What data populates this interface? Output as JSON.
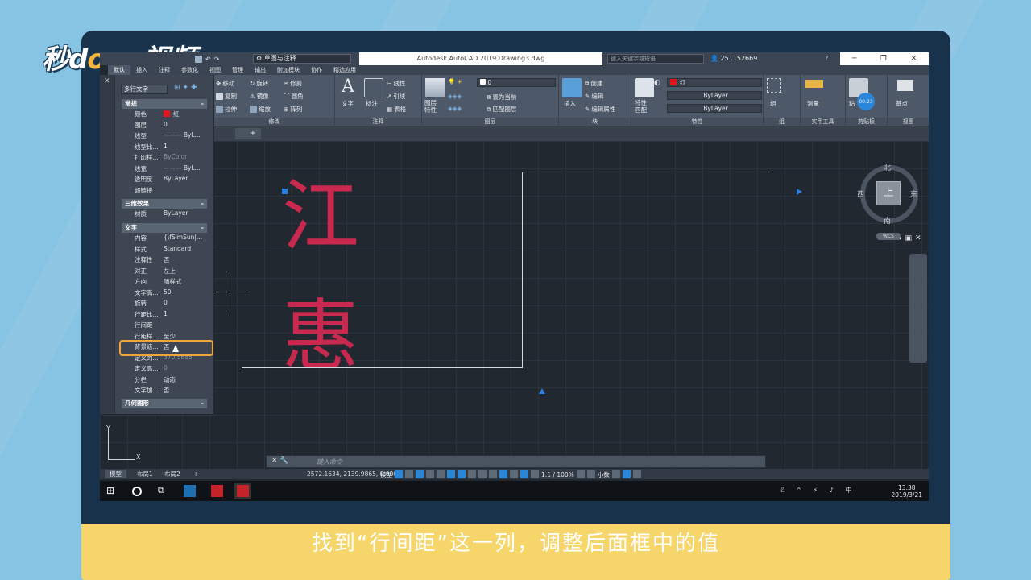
{
  "logo": {
    "text_a": "秒d",
    "dot": "o",
    "text_b": "ng视频"
  },
  "window": {
    "workspace": "草图与注释",
    "title": "Autodesk AutoCAD 2019    Drawing3.dwg",
    "search_placeholder": "键入关键字或短语",
    "user": "251152669",
    "help": "?"
  },
  "ribbon_tabs": [
    "默认",
    "插入",
    "注释",
    "参数化",
    "视图",
    "管理",
    "输出",
    "附加模块",
    "协作",
    "精选应用"
  ],
  "ribbon": {
    "modify": {
      "label": "修改",
      "move": "移动",
      "rotate": "旋转",
      "trim": "修剪",
      "copy": "复制",
      "mirror": "镜像",
      "fillet": "圆角",
      "stretch": "拉伸",
      "scale": "缩放",
      "array": "阵列"
    },
    "annotation": {
      "label": "注释",
      "text": "文字",
      "dim": "标注",
      "linear": "线性",
      "leader": "引线",
      "table": "表格"
    },
    "layers": {
      "label": "图层",
      "props": "图层\n特性",
      "current_layer": "0",
      "set_current": "置为当前",
      "match": "匹配图层"
    },
    "block": {
      "label": "块",
      "insert": "插入",
      "create": "创建",
      "edit": "编辑",
      "edit_attr": "编辑属性"
    },
    "properties": {
      "label": "特性",
      "match": "特性\n匹配",
      "color": "红",
      "linetype": "ByLayer",
      "lineweight": "ByLayer"
    },
    "groups": {
      "label": "组",
      "group": "组"
    },
    "utilities": {
      "label": "实用工具",
      "measure": "测量"
    },
    "clipboard": {
      "label": "剪贴板",
      "paste": "粘",
      "timer": "00:23"
    },
    "view": {
      "label": "视图",
      "base": "基点"
    }
  },
  "palette": {
    "selector": "多行文字",
    "sections": {
      "general": "常规",
      "three_d": "三维效果",
      "text": "文字",
      "geometry": "几何图形"
    },
    "general_rows": [
      {
        "k": "颜色",
        "v": "红",
        "swatch": true
      },
      {
        "k": "图层",
        "v": "0"
      },
      {
        "k": "线型",
        "v": "——— ByL..."
      },
      {
        "k": "线型比...",
        "v": "1"
      },
      {
        "k": "打印样...",
        "v": "ByColor",
        "dim": true
      },
      {
        "k": "线宽",
        "v": "——— ByL..."
      },
      {
        "k": "透明度",
        "v": "ByLayer"
      },
      {
        "k": "超链接",
        "v": ""
      }
    ],
    "three_d_rows": [
      {
        "k": "材质",
        "v": "ByLayer"
      }
    ],
    "text_rows": [
      {
        "k": "内容",
        "v": "{\\fSimSun|..."
      },
      {
        "k": "样式",
        "v": "Standard"
      },
      {
        "k": "注释性",
        "v": "否"
      },
      {
        "k": "对正",
        "v": "左上"
      },
      {
        "k": "方向",
        "v": "随样式"
      },
      {
        "k": "文字高...",
        "v": "50"
      },
      {
        "k": "旋转",
        "v": "0"
      },
      {
        "k": "行距比...",
        "v": "1"
      },
      {
        "k": "行间距",
        "v": ""
      },
      {
        "k": "行距样...",
        "v": "至少"
      },
      {
        "k": "背景遮...",
        "v": "否"
      },
      {
        "k": "定义的...",
        "v": "370.5685",
        "dim": true
      },
      {
        "k": "定义高...",
        "v": "0",
        "dim": true
      },
      {
        "k": "分栏",
        "v": "动态"
      },
      {
        "k": "文字加...",
        "v": "否"
      }
    ]
  },
  "drawing": {
    "char1": "江",
    "char2": "惠"
  },
  "viewcube": {
    "north": "北",
    "south": "南",
    "east": "东",
    "west": "西",
    "top": "上",
    "wcs": "WCS"
  },
  "command": {
    "placeholder": "键入命令"
  },
  "layout_tabs": [
    "模型",
    "布局1",
    "布局2",
    "+"
  ],
  "status": {
    "coords": "2572.1634, 2139.9865, 0.0000",
    "model": "模型",
    "scale": "1:1 / 100%",
    "units": "小数"
  },
  "taskbar": {
    "time": "13:38",
    "date": "2019/3/21",
    "ime": "中",
    "notif": "2"
  },
  "caption": "找到“行间距”这一列，调整后面框中的值",
  "colors": {
    "accent": "#f2a53b",
    "text_red": "#c9294f",
    "frame": "#17324a",
    "caption_bg": "#f6d56a"
  }
}
